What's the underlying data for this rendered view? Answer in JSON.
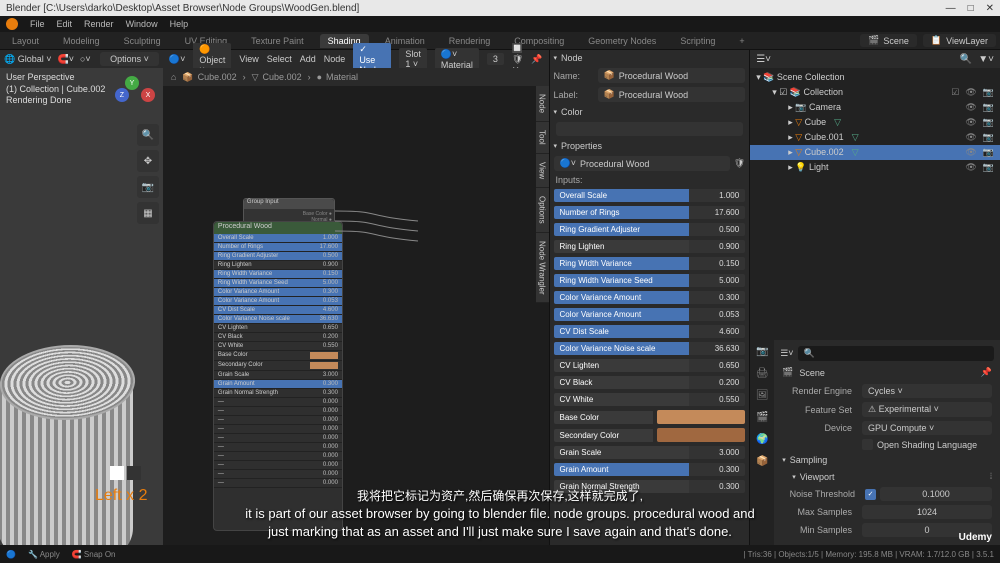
{
  "window": {
    "title": "Blender [C:\\Users\\darko\\Desktop\\Asset Browser\\Node Groups\\WoodGen.blend]",
    "controls": [
      "—",
      "□",
      "✕"
    ]
  },
  "menubar": [
    "File",
    "Edit",
    "Render",
    "Window",
    "Help"
  ],
  "workspaces": [
    "Layout",
    "Modeling",
    "Sculpting",
    "UV Editing",
    "Texture Paint",
    "Shading",
    "Animation",
    "Rendering",
    "Compositing",
    "Geometry Nodes",
    "Scripting"
  ],
  "active_workspace": "Shading",
  "scene_name": "Scene",
  "viewlayer_name": "ViewLayer",
  "viewport": {
    "mode": "Global",
    "info_line1": "User Perspective",
    "info_line2": "(1) Collection | Cube.002",
    "info_line3": "Rendering Done",
    "options_label": "Options",
    "left_text": "Left x 2"
  },
  "node_editor": {
    "header": {
      "object_btn": "Object",
      "menus": [
        "View",
        "Select",
        "Add",
        "Node"
      ],
      "use_nodes": "Use Nodes",
      "slot": "Slot 1",
      "material": "Material",
      "count": "3"
    },
    "breadcrumb": [
      "Cube.002",
      "Cube.002",
      "Material"
    ],
    "node_group_title": "Procedural Wood",
    "side_tabs": [
      "Node",
      "Tool",
      "View",
      "Options",
      "Node Wrangler"
    ]
  },
  "node_panel": {
    "section1": "Node",
    "name_label": "Name:",
    "name_value": "Procedural Wood",
    "label_label": "Label:",
    "label_value": "Procedural Wood",
    "color_section": "Color",
    "props_section": "Properties",
    "material_name": "Procedural Wood",
    "inputs_label": "Inputs:",
    "inputs": [
      {
        "label": "Overall Scale",
        "value": "1.000",
        "hl": true
      },
      {
        "label": "Number of Rings",
        "value": "17.600",
        "hl": true
      },
      {
        "label": "Ring Gradient Adjuster",
        "value": "0.500",
        "hl": true
      },
      {
        "label": "Ring Lighten",
        "value": "0.900",
        "hl": false
      },
      {
        "label": "Ring Width Variance",
        "value": "0.150",
        "hl": true
      },
      {
        "label": "Ring Width Variance Seed",
        "value": "5.000",
        "hl": true
      },
      {
        "label": "Color Variance Amount",
        "value": "0.300",
        "hl": true
      },
      {
        "label": "Color Variance Amount",
        "value": "0.053",
        "hl": true
      },
      {
        "label": "CV Dist Scale",
        "value": "4.600",
        "hl": true
      },
      {
        "label": "Color Variance Noise scale",
        "value": "36.630",
        "hl": true
      },
      {
        "label": "CV Lighten",
        "value": "0.650",
        "hl": false
      },
      {
        "label": "CV Black",
        "value": "0.200",
        "hl": false
      },
      {
        "label": "CV White",
        "value": "0.550",
        "hl": false
      }
    ],
    "base_color": "Base Color",
    "secondary_color": "Secondary Color",
    "inputs2": [
      {
        "label": "Grain Scale",
        "value": "3.000",
        "hl": false
      },
      {
        "label": "Grain Amount",
        "value": "0.300",
        "hl": true
      },
      {
        "label": "Grain Normal Strength",
        "value": "0.300",
        "hl": false
      }
    ]
  },
  "outliner": {
    "root": "Scene Collection",
    "collection": "Collection",
    "items": [
      {
        "name": "Camera",
        "type": "camera"
      },
      {
        "name": "Cube",
        "type": "mesh"
      },
      {
        "name": "Cube.001",
        "type": "mesh"
      },
      {
        "name": "Cube.002",
        "type": "mesh",
        "selected": true
      },
      {
        "name": "Light",
        "type": "light"
      }
    ]
  },
  "properties": {
    "scene_label": "Scene",
    "render_engine_label": "Render Engine",
    "render_engine": "Cycles",
    "feature_set_label": "Feature Set",
    "feature_set": "Experimental",
    "device_label": "Device",
    "device": "GPU Compute",
    "osl_label": "Open Shading Language",
    "sampling_header": "Sampling",
    "viewport_header": "Viewport",
    "noise_threshold_label": "Noise Threshold",
    "noise_threshold": "0.1000",
    "max_samples_label": "Max Samples",
    "max_samples": "1024",
    "min_samples_label": "Min Samples",
    "min_samples": "0"
  },
  "footer": {
    "apply": "Apply",
    "snap": "Snap On",
    "stats": "| Tris:36 | Objects:1/5 | Memory: 195.8 MB | VRAM: 1.7/12.0 GB | 3.5.1"
  },
  "subtitles": {
    "zh": "我将把它标记为资产,然后确保再次保存,这样就完成了,",
    "en1": "it is part of our asset browser by going to blender file. node groups. procedural wood and",
    "en2": "just marking that as an asset and I'll just make sure I save again and that's done."
  },
  "udemy": "Udemy"
}
